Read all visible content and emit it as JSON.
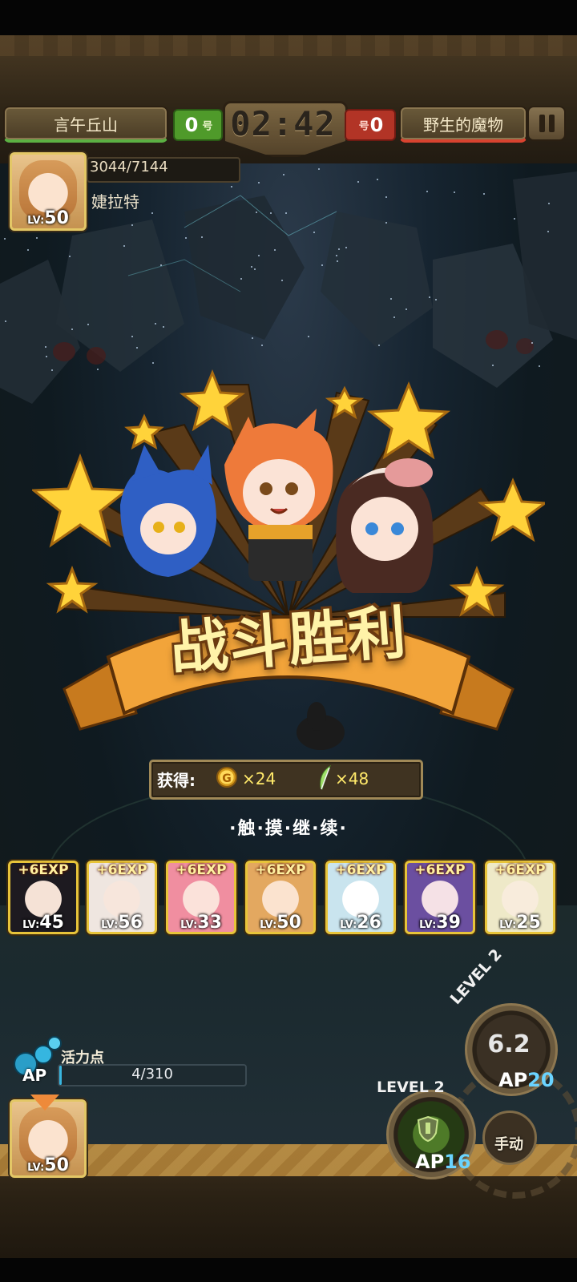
{
  "hud": {
    "left_team": "言午丘山",
    "left_score": "0",
    "timer": "02:42",
    "right_score": "0",
    "right_team": "野生的魔物",
    "score_glyph": "号"
  },
  "hero": {
    "hp_text": "3044/7144",
    "name": "婕拉特",
    "level": "50"
  },
  "victory": {
    "title": "战斗胜利"
  },
  "rewards": {
    "label": "获得:",
    "coin_letter": "G",
    "gold": "×24",
    "feathers": "×48"
  },
  "continue_text": "·触·摸·继·续·",
  "lv_prefix": "LV:",
  "exp_cards": [
    {
      "exp": "+6EXP",
      "level": "45",
      "hair": "#1d1a20",
      "skin": "#f5e2d6"
    },
    {
      "exp": "+6EXP",
      "level": "56",
      "hair": "#efe6e0",
      "skin": "#f7e6dc"
    },
    {
      "exp": "+6EXP",
      "level": "33",
      "hair": "#f08ea0",
      "skin": "#fbe2da"
    },
    {
      "exp": "+6EXP",
      "level": "50",
      "hair": "#e3a860",
      "skin": "#fbe3cf"
    },
    {
      "exp": "+6EXP",
      "level": "26",
      "hair": "#c9e4ee",
      "skin": "#ffffff"
    },
    {
      "exp": "+6EXP",
      "level": "39",
      "hair": "#6b4fa0",
      "skin": "#f5e1e6"
    },
    {
      "exp": "+6EXP",
      "level": "25",
      "hair": "#eee9c8",
      "skin": "#f8ecdc"
    }
  ],
  "ap": {
    "label": "活力点",
    "badge": "AP",
    "text": "4/310",
    "fraction": 0.0129
  },
  "active_hero": {
    "level": "50"
  },
  "skills": [
    {
      "level_label": "LEVEL 2",
      "cooldown": "6.2",
      "ap_prefix": "AP",
      "ap_cost": "20"
    },
    {
      "level_label": "LEVEL 2",
      "ap_prefix": "AP",
      "ap_cost": "16"
    }
  ],
  "manual_label": "手动",
  "colors": {
    "left_team": "#4f9a2a",
    "right_team": "#b23426",
    "gold_text": "#ffe96a",
    "card_border": "#e7c43a"
  }
}
